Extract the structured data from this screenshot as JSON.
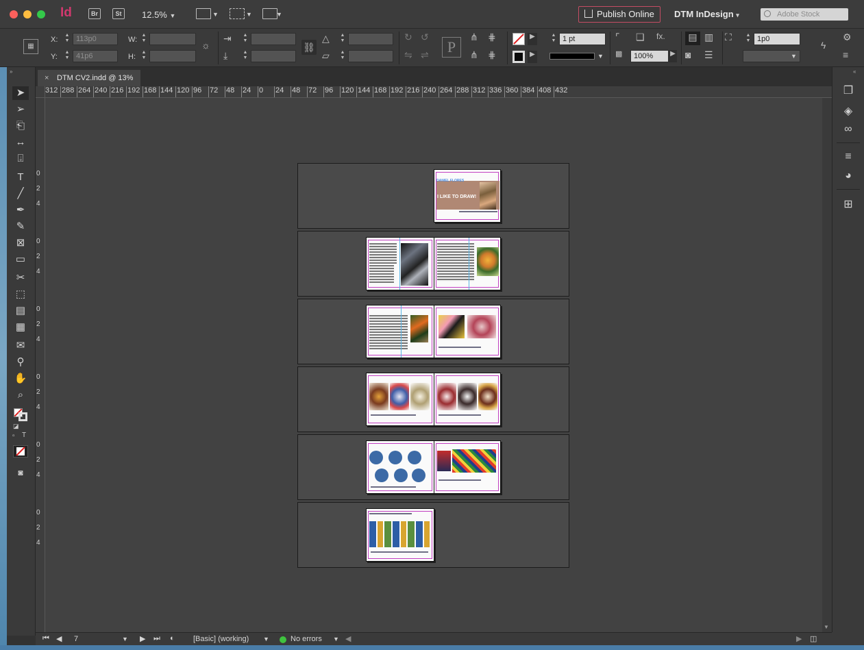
{
  "app": {
    "logo": "Id",
    "bridge": "Br",
    "stock_btn": "St",
    "zoom": "12.5%",
    "publish_online": "Publish Online",
    "workspace": "DTM InDesign",
    "search_placeholder": "Adobe Stock"
  },
  "control": {
    "x_label": "X:",
    "x_value": "113p0",
    "y_label": "Y:",
    "y_value": "41p6",
    "w_label": "W:",
    "w_value": "",
    "h_label": "H:",
    "h_value": "",
    "stroke_weight": "1 pt",
    "opacity": "100%",
    "fx_label": "fx.",
    "offset_value": "1p0"
  },
  "document": {
    "tab_title": "DTM CV2.indd @ 13%",
    "close": "×"
  },
  "ruler": {
    "h_ticks": [
      "312",
      "288",
      "264",
      "240",
      "216",
      "192",
      "168",
      "144",
      "120",
      "96",
      "72",
      "48",
      "24",
      "0",
      "24",
      "48",
      "72",
      "96",
      "120",
      "144",
      "168",
      "192",
      "216",
      "240",
      "264",
      "288",
      "312",
      "336",
      "360",
      "384",
      "408",
      "432"
    ],
    "v_ticks": [
      "0",
      "2",
      "4",
      "0",
      "2",
      "4",
      "0",
      "2",
      "4",
      "0",
      "2",
      "4",
      "0",
      "2",
      "4",
      "0",
      "2",
      "4"
    ]
  },
  "pages": {
    "cover_name": "DANIEL FLORES",
    "cover_tagline": "I LIKE TO DRAW!"
  },
  "status": {
    "page_number": "7",
    "preflight_profile": "[Basic] (working)",
    "errors": "No errors"
  },
  "colors": {
    "accent": "#d1386e",
    "guide_margin": "#c13ec1",
    "guide_column": "#58b4e6",
    "ok": "#3fc33f"
  }
}
